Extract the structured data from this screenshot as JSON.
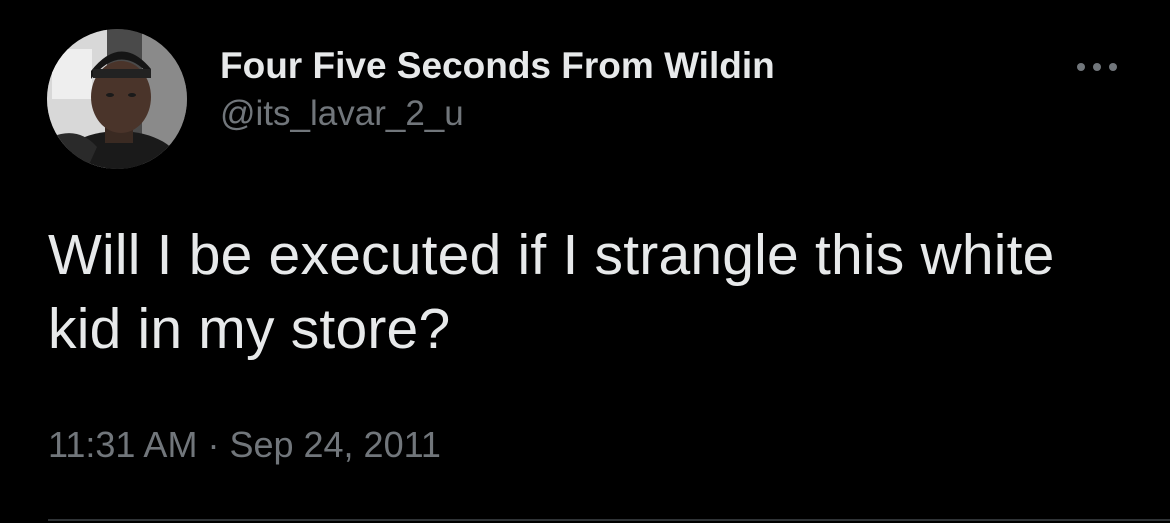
{
  "user": {
    "display_name": "Four Five Seconds From Wildin",
    "handle": "@its_lavar_2_u"
  },
  "tweet": {
    "text": "Will I be executed if I strangle this white kid in my store?",
    "time": "11:31 AM",
    "separator": "·",
    "date": "Sep 24, 2011"
  },
  "icons": {
    "more": "more-horizontal-icon",
    "avatar": "profile-photo"
  },
  "colors": {
    "background": "#000000",
    "primary_text": "#e7e9ea",
    "secondary_text": "#71767b",
    "divider": "#2f3336"
  }
}
